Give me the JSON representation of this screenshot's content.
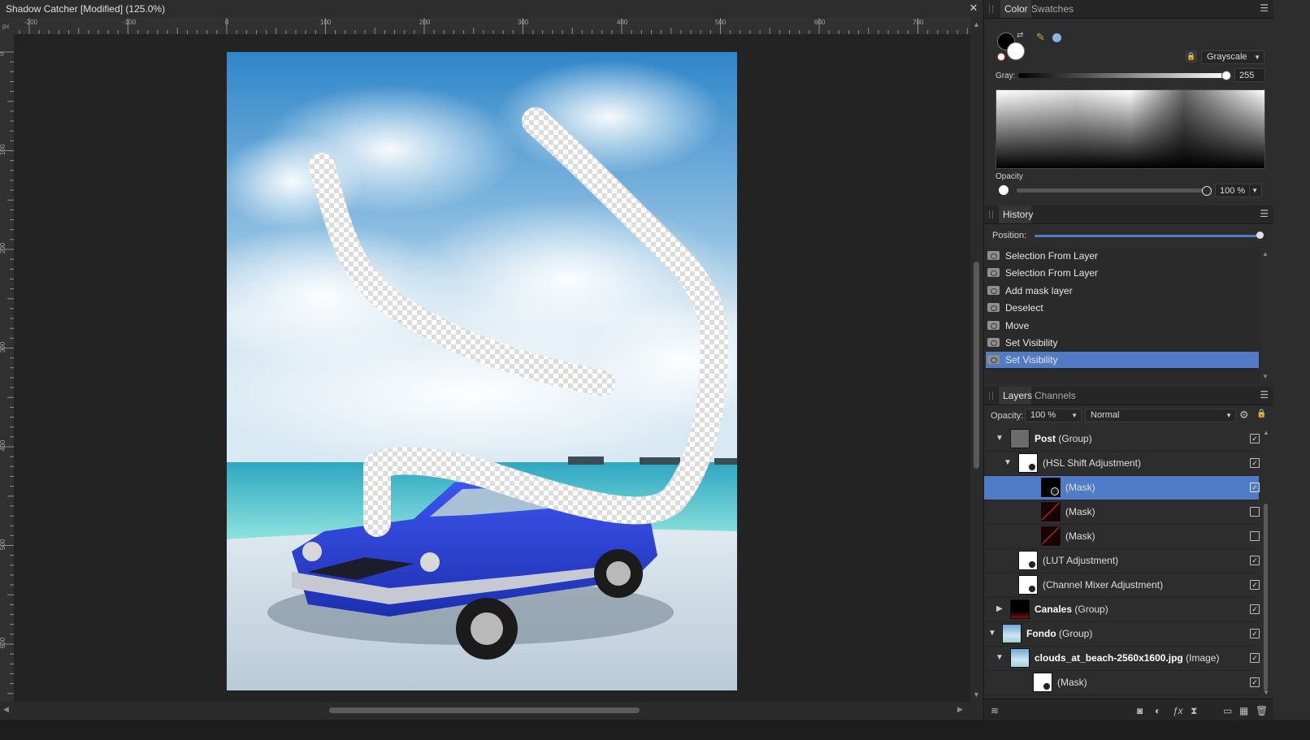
{
  "document": {
    "title": "Shadow Catcher [Modified] (125.0%)",
    "close_glyph": "✕",
    "ruler_unit": "px",
    "ruler_top_labels": [
      "-200",
      "-100",
      "0",
      "100",
      "200",
      "300",
      "400",
      "500",
      "600",
      "700"
    ],
    "ruler_left_labels": [
      "0",
      "100",
      "200",
      "300",
      "400",
      "500",
      "600"
    ]
  },
  "color_panel": {
    "tabs": [
      "Color",
      "Swatches"
    ],
    "active_tab": "Color",
    "model": "Grayscale",
    "gray_label": "Gray:",
    "gray_value": "255",
    "opacity_label": "Opacity",
    "opacity_value": "100 %",
    "primary_color": "#000000",
    "secondary_color": "#ffffff",
    "accent_dot_color": "#8ab4e6"
  },
  "history_panel": {
    "title": "History",
    "position_label": "Position:",
    "items": [
      "Selection From Layer",
      "Selection From Layer",
      "Add mask layer",
      "Deselect",
      "Move",
      "Set Visibility",
      "Set Visibility"
    ],
    "selected_index": 6
  },
  "layers_panel": {
    "tabs": [
      "Layers",
      "Channels"
    ],
    "active_tab": "Layers",
    "opacity_label": "Opacity:",
    "opacity_value": "100 %",
    "blend_mode": "Normal",
    "layers": [
      {
        "name": "Post",
        "type": "(Group)",
        "checked": true
      },
      {
        "name": "",
        "type": "(HSL Shift Adjustment)",
        "checked": true
      },
      {
        "name": "",
        "type": "(Mask)",
        "checked": true,
        "selected": true
      },
      {
        "name": "",
        "type": "(Mask)",
        "checked": false
      },
      {
        "name": "",
        "type": "(Mask)",
        "checked": false
      },
      {
        "name": "",
        "type": "(LUT Adjustment)",
        "checked": true
      },
      {
        "name": "",
        "type": "(Channel Mixer Adjustment)",
        "checked": true
      },
      {
        "name": "Canales",
        "type": "(Group)",
        "checked": true
      },
      {
        "name": "Fondo",
        "type": "(Group)",
        "checked": true
      },
      {
        "name": "clouds_at_beach-2560x1600.jpg",
        "type": "(Image)",
        "checked": true
      },
      {
        "name": "",
        "type": "(Mask)",
        "checked": true
      }
    ]
  },
  "colors": {
    "selection": "#4f7bc7",
    "car_blue": "#2a40d8",
    "sky_top": "#2f86c9",
    "sea": "#5fd2d6"
  }
}
